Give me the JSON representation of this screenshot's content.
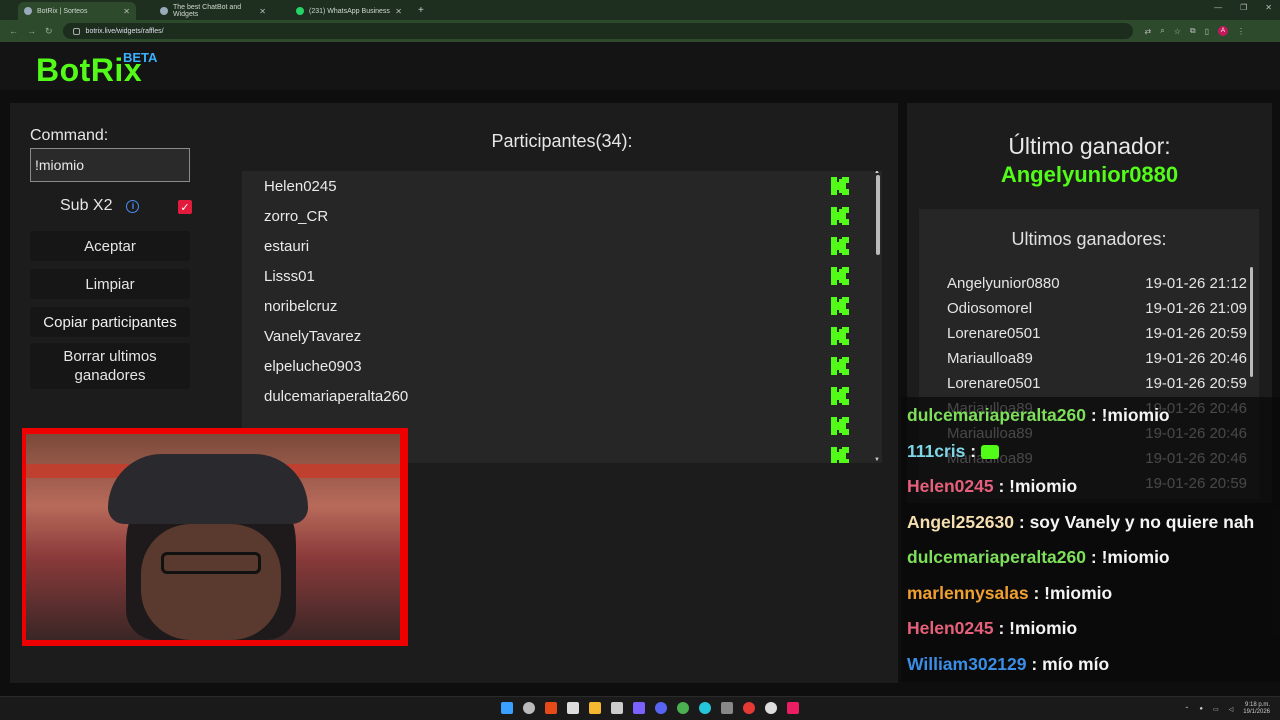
{
  "browser": {
    "tabs": [
      {
        "label": "BotRix | Sorteos",
        "active": true
      },
      {
        "label": "The best ChatBot and Widgets",
        "active": false
      },
      {
        "label": "(231) WhatsApp Business",
        "active": false
      }
    ],
    "url": "botrix.live/widgets/raffles/"
  },
  "header": {
    "logo": "BotRix",
    "badge": "BETA"
  },
  "controls": {
    "command_label": "Command:",
    "command_value": "!miomio",
    "sub_label": "Sub X2",
    "sub_checked": true,
    "accept_label": "Aceptar",
    "clear_label": "Limpiar",
    "copy_label": "Copiar participantes",
    "delete_label": "Borrar ultimos ganadores"
  },
  "participants": {
    "title": "Participantes(34):",
    "names": [
      "Helen0245",
      "zorro_CR",
      "estauri",
      "Lisss01",
      "noribelcruz",
      "VanelyTavarez",
      "elpeluche0903",
      "dulcemariaperalta260",
      "",
      ""
    ]
  },
  "winner": {
    "title": "Último ganador:",
    "name": "Angelyunior0880"
  },
  "history": {
    "title": "Ultimos ganadores:",
    "rows": [
      {
        "name": "Angelyunior0880",
        "date": "19-01-26 21:12"
      },
      {
        "name": "Odiosomorel",
        "date": "19-01-26 21:09"
      },
      {
        "name": "Lorenare0501",
        "date": "19-01-26 20:59"
      },
      {
        "name": "Mariaulloa89",
        "date": "19-01-26 20:46"
      },
      {
        "name": "Lorenare0501",
        "date": "19-01-26 20:59"
      },
      {
        "name": "Mariaulloa89",
        "date": "19-01-26 20:46"
      },
      {
        "name": "Mariaulloa89",
        "date": "19-01-26 20:46"
      },
      {
        "name": "Mariaulloa89",
        "date": "19-01-26 20:46"
      },
      {
        "name": "",
        "date": "19-01-26 20:59"
      }
    ]
  },
  "chat": [
    {
      "user": "dulcemariaperalta260",
      "color": "#7ee05a",
      "message": "!miomio"
    },
    {
      "user": "111cris",
      "color": "#7fd6e6",
      "message": ""
    },
    {
      "user": "Helen0245",
      "color": "#e5607a",
      "message": "!miomio"
    },
    {
      "user": "Angel252630",
      "color": "#f5deb0",
      "message": "soy Vanely y no quiere nah"
    },
    {
      "user": "dulcemariaperalta260",
      "color": "#7ee05a",
      "message": "!miomio"
    },
    {
      "user": "marlennysalas",
      "color": "#f0a030",
      "message": "!miomio"
    },
    {
      "user": "Helen0245",
      "color": "#e5607a",
      "message": "!miomio"
    },
    {
      "user": "William302129",
      "color": "#3a8ee6",
      "message": "mío mío"
    }
  ],
  "taskbar": {
    "time": "9:18 p.m.",
    "date": "19/1/2026"
  },
  "colors": {
    "brand": "#53fc18",
    "beta": "#3ab0ff",
    "checkbox": "#e21b3c",
    "webcam_border": "#ee0000"
  }
}
